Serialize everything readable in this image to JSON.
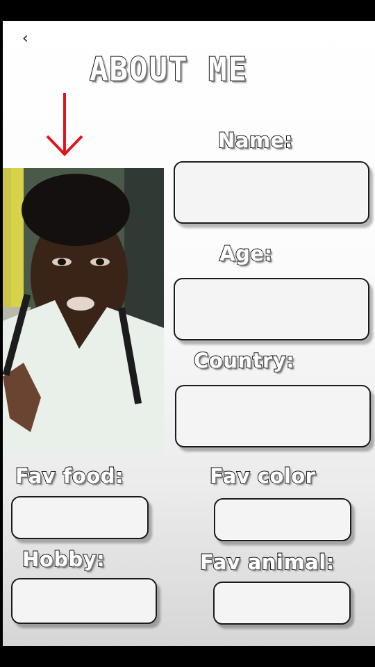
{
  "page": {
    "title": "ABOUT ME"
  },
  "fields": {
    "name_label": "Name:",
    "age_label": "Age:",
    "country_label": "Country:",
    "fav_food_label": "Fav food:",
    "fav_color_label": "Fav color",
    "hobby_label": "Hobby:",
    "fav_animal_label": "Fav animal:",
    "name_value": "",
    "age_value": "",
    "country_value": "",
    "fav_food_value": "",
    "fav_color_value": "",
    "hobby_value": "",
    "fav_animal_value": ""
  },
  "icons": {
    "back": "chevron-left-icon",
    "arrow": "red-down-arrow-icon"
  },
  "colors": {
    "arrow": "#e0141e",
    "label_fill": "#ffffff",
    "label_stroke": "#111111",
    "background": "#000000"
  }
}
